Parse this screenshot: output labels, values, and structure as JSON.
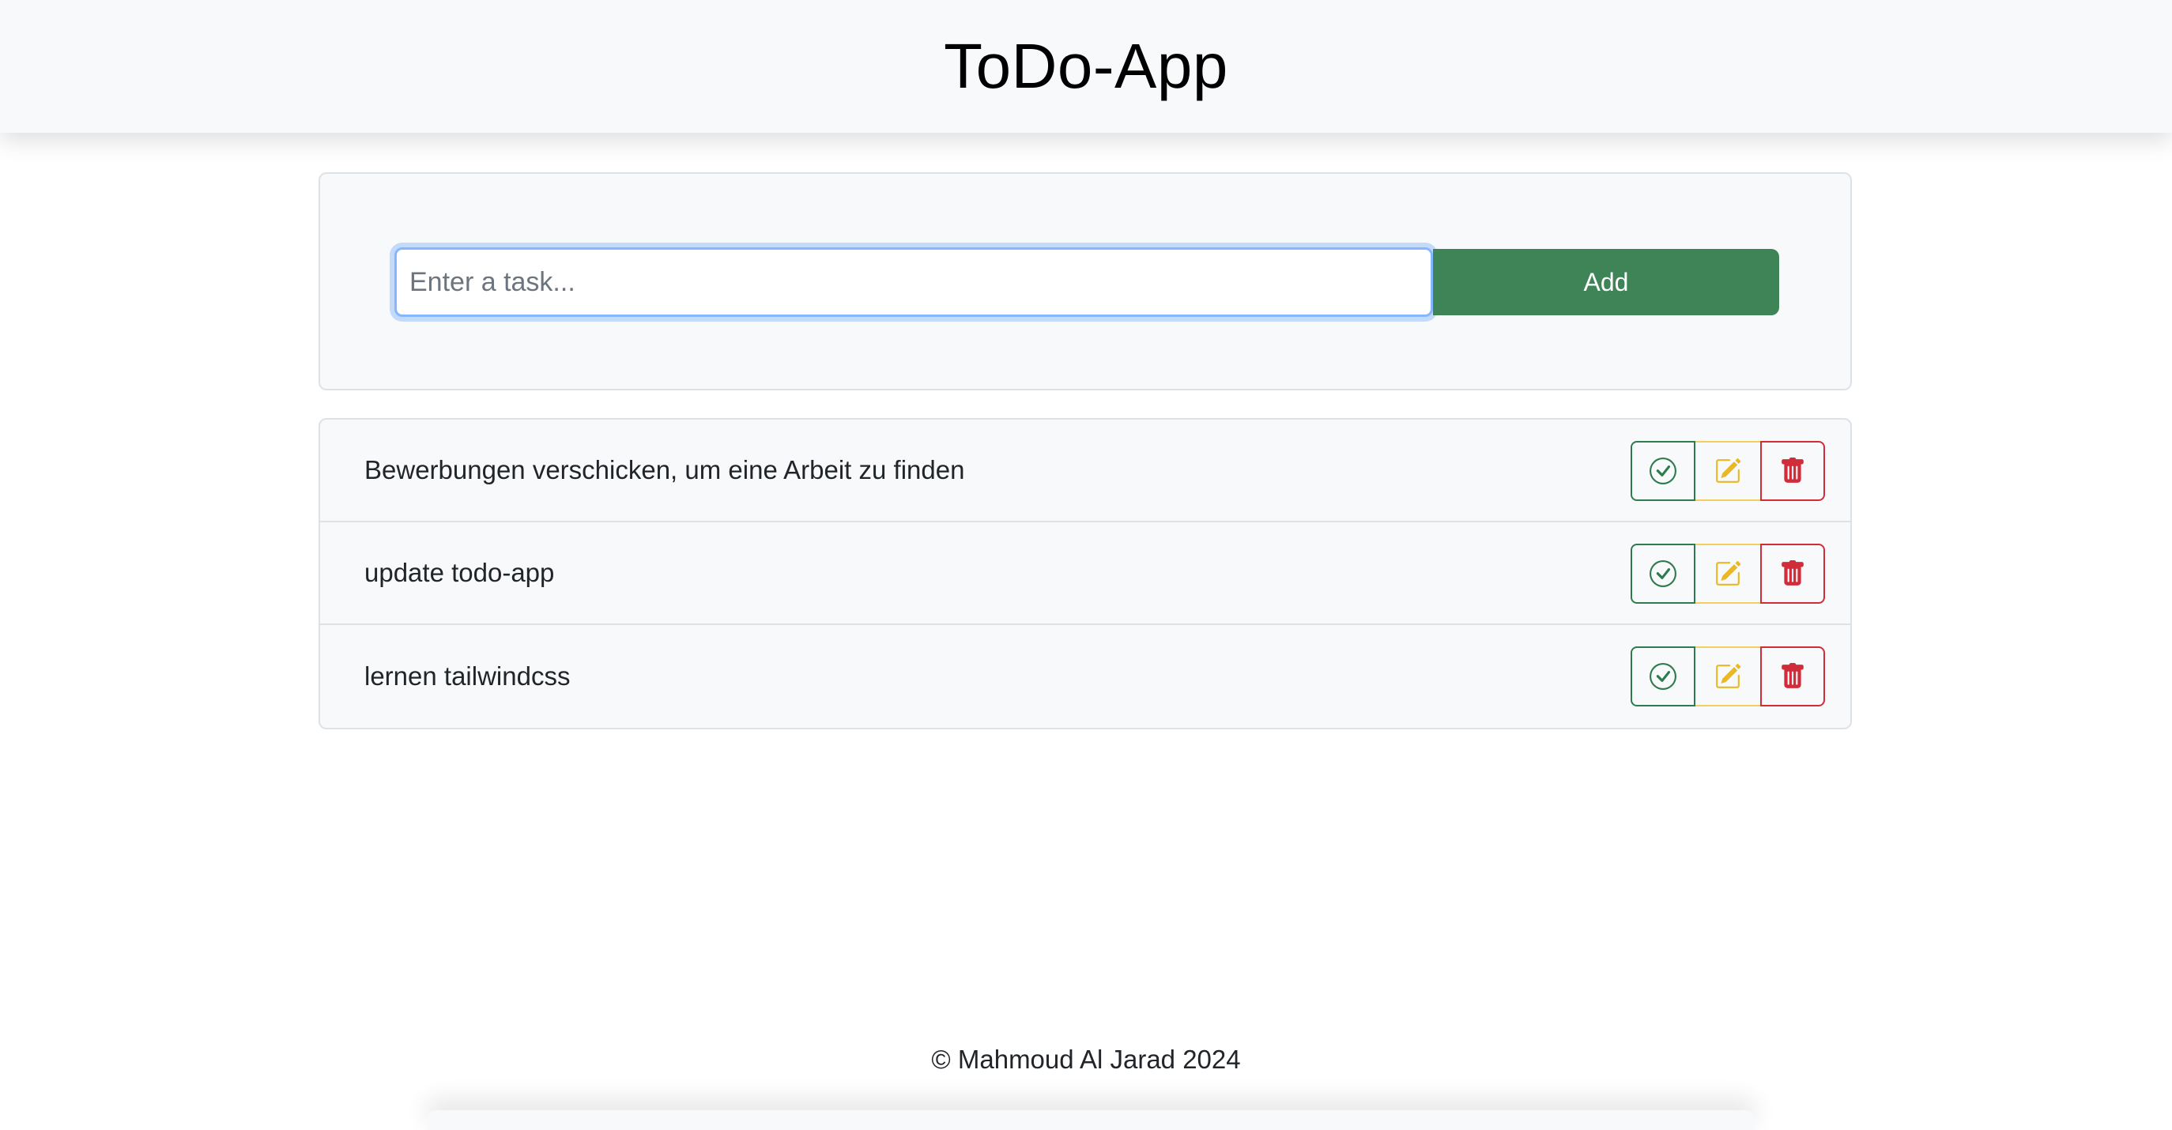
{
  "header": {
    "title": "ToDo-App"
  },
  "new_task": {
    "placeholder": "Enter a task...",
    "value": "",
    "add_label": "Add"
  },
  "tasks": [
    {
      "text": "Bewerbungen verschicken, um eine Arbeit zu finden"
    },
    {
      "text": "update todo-app"
    },
    {
      "text": "lernen tailwindcss"
    }
  ],
  "actions": {
    "done_icon": "check-circle-icon",
    "edit_icon": "pencil-square-icon",
    "delete_icon": "trash-icon"
  },
  "footer": {
    "copyright": "© Mahmoud Al Jarad 2024"
  },
  "colors": {
    "success": "#3e8457",
    "warning": "#f5cf5d",
    "danger": "#d12c3a",
    "focus": "#86b7fe"
  }
}
